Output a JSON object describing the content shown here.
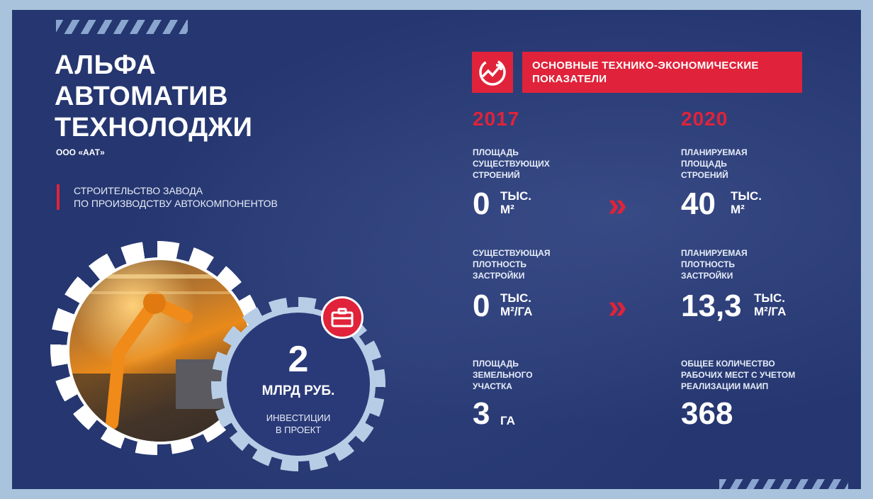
{
  "title_lines": [
    "Альфа",
    "Автоматив",
    "Технолоджи"
  ],
  "company": "ООО «ААТ»",
  "subtitle_lines": [
    "Строительство завода",
    "по производству автокомпонентов"
  ],
  "investment": {
    "value": "2",
    "unit": "млрд руб.",
    "text_lines": [
      "Инвестиции",
      "в проект"
    ],
    "icon": "briefcase-icon"
  },
  "header": {
    "icon": "growth-chart-logo-icon",
    "lines": [
      "Основные технико-экономические",
      "показатели"
    ]
  },
  "years": [
    "2017",
    "2020"
  ],
  "metrics_2017": [
    {
      "label_lines": [
        "Площадь",
        "существующих",
        "строений"
      ],
      "value": "0",
      "unit_lines": [
        "тыс.",
        "м²"
      ]
    },
    {
      "label_lines": [
        "Существующая",
        "плотность",
        "застройки"
      ],
      "value": "0",
      "unit_lines": [
        "тыс.",
        "м²/га"
      ]
    },
    {
      "label_lines": [
        "Площадь",
        "земельного",
        "участка"
      ],
      "value": "3",
      "unit_lines": [
        "га"
      ]
    }
  ],
  "metrics_2020": [
    {
      "label_lines": [
        "Планируемая",
        "площадь",
        "строений"
      ],
      "value": "40",
      "unit_lines": [
        "тыс.",
        "м²"
      ]
    },
    {
      "label_lines": [
        "Планируемая",
        "плотность",
        "застройки"
      ],
      "value": "13,3",
      "unit_lines": [
        "тыс.",
        "м²/га"
      ]
    },
    {
      "label_lines": [
        "Общее количество",
        "рабочих мест  с учетом",
        "реализации МаИП"
      ],
      "value": "368"
    }
  ],
  "arrow_glyph": "»",
  "colors": {
    "background": "#253670",
    "accent": "#e0233a",
    "frame": "#a9c3dc",
    "gear": "#b7cde6"
  }
}
